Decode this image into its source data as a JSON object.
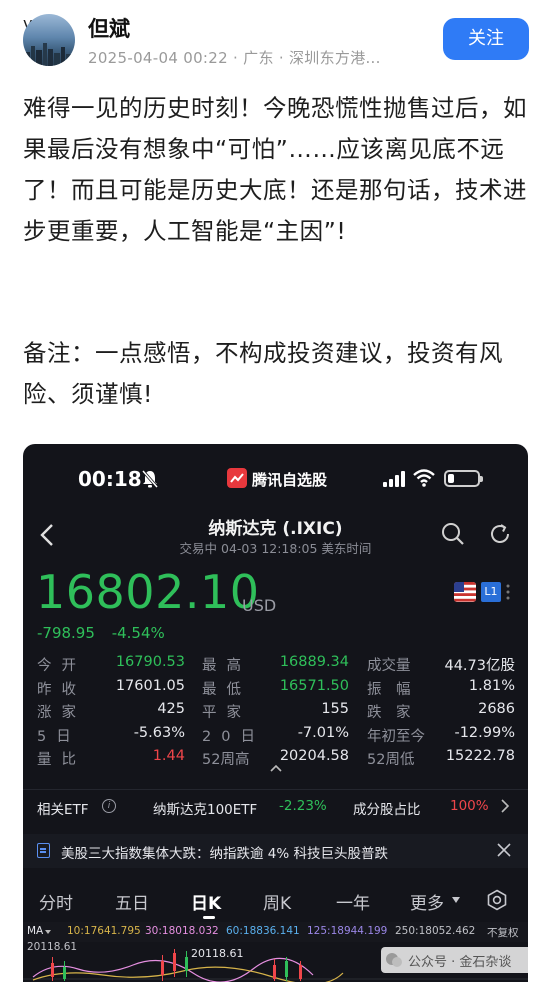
{
  "post": {
    "author": "但斌",
    "verified_badge": "v",
    "timestamp": "2025-04-04 00:22",
    "location": "· 广东 · 深圳东方港...",
    "follow_label": "关注",
    "body": "难得一见的历史时刻！今晚恐慌性抛售过后，如果最后没有想象中“可怕”……应该离见底不远了！而且可能是历史大底！还是那句话，技术进步更重要，人工智能是“主因”!",
    "note": "备注：一点感悟，不构成投资建议，投资有风险、须谨慎!"
  },
  "screenshot": {
    "status_bar": {
      "time": "00:18",
      "app_name": "腾讯自选股",
      "icons": [
        "bell-muted-icon",
        "signal-icon",
        "wifi-icon",
        "battery-icon"
      ]
    },
    "header": {
      "title": "纳斯达克 (.IXIC)",
      "subtitle": "交易中   04-03 12:18:05 美东时间"
    },
    "quote": {
      "price": "16802.10",
      "currency": "USD",
      "change": "-798.95",
      "change_pct": "-4.54%",
      "level_badge": "L1"
    },
    "stats": [
      [
        {
          "label": "今开",
          "value": "16790.53",
          "color": "green"
        },
        {
          "label": "最高",
          "value": "16889.34",
          "color": "green"
        },
        {
          "label": "成交量",
          "value": "44.73亿股",
          "color": "white"
        }
      ],
      [
        {
          "label": "昨收",
          "value": "17601.05",
          "color": "white"
        },
        {
          "label": "最低",
          "value": "16571.50",
          "color": "green"
        },
        {
          "label": "振　幅",
          "value": "1.81%",
          "color": "white"
        }
      ],
      [
        {
          "label": "涨家",
          "value": "425",
          "color": "white"
        },
        {
          "label": "平家",
          "value": "155",
          "color": "white"
        },
        {
          "label": "跌　家",
          "value": "2686",
          "color": "white"
        }
      ],
      [
        {
          "label": "5日",
          "value": "-5.63%",
          "color": "white"
        },
        {
          "label": "20日",
          "value": "-7.01%",
          "color": "white"
        },
        {
          "label": "年初至今",
          "value": "-12.99%",
          "color": "white"
        }
      ],
      [
        {
          "label": "量比",
          "value": "1.44",
          "color": "red"
        },
        {
          "label": "52周高",
          "value": "20204.58",
          "color": "white"
        },
        {
          "label": "52周低",
          "value": "15222.78",
          "color": "white"
        }
      ]
    ],
    "etf": {
      "label": "相关ETF",
      "etf_name": "纳斯达克100ETF",
      "etf_change": "-2.23%",
      "component_label": "成分股占比",
      "component_value": "100%"
    },
    "news": {
      "text": "美股三大指数集体大跌：纳指跌逾 4% 科技巨头股普跌"
    },
    "tabs": [
      {
        "label": "分时",
        "active": false
      },
      {
        "label": "五日",
        "active": false
      },
      {
        "label": "日K",
        "active": true
      },
      {
        "label": "周K",
        "active": false
      },
      {
        "label": "一年",
        "active": false
      },
      {
        "label": "更多",
        "active": false
      }
    ],
    "ma": {
      "type": "MA",
      "ma10": "10:17641.795",
      "ma30": "30:18018.032",
      "ma60": "60:18836.141",
      "ma125": "125:18944.199",
      "ma250": "250:18052.462",
      "adjust": "不复权"
    },
    "chart_high": "20118.61",
    "chart_high_label": "20118.61"
  },
  "watermark": "公众号 · 金石杂谈",
  "colors": {
    "follow_blue": "#2f7bf6",
    "down_green": "#2fbf5a",
    "up_red": "#f0464a",
    "panel_bg": "#13141a"
  }
}
